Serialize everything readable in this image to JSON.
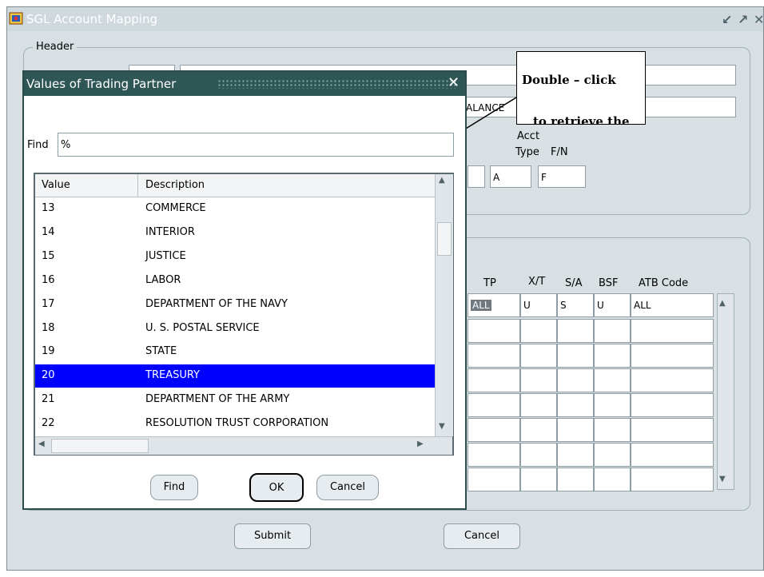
{
  "window": {
    "title": "SGL Account Mapping"
  },
  "header_group": {
    "legend": "Header",
    "balance_fragment": "ALANCE",
    "col_labels": [
      "Acct",
      "Type",
      "F/N"
    ],
    "values": {
      "acct_type": "A",
      "fn": "F"
    }
  },
  "detail_group": {
    "columns": [
      "TP",
      "X/T",
      "S/A",
      "BSF",
      "ATB Code"
    ],
    "first_row": [
      "ALL",
      "U",
      "S",
      "U",
      "ALL"
    ]
  },
  "footer": {
    "submit_label": "Submit",
    "cancel_label": "Cancel"
  },
  "dialog": {
    "title": "Values of Trading Partner",
    "find_label": "Find",
    "find_value": "%",
    "columns": [
      "Value",
      "Description"
    ],
    "rows": [
      {
        "value": "13",
        "description": "COMMERCE"
      },
      {
        "value": "14",
        "description": "INTERIOR"
      },
      {
        "value": "15",
        "description": "JUSTICE"
      },
      {
        "value": "16",
        "description": "LABOR"
      },
      {
        "value": "17",
        "description": "DEPARTMENT OF THE NAVY"
      },
      {
        "value": "18",
        "description": "U. S. POSTAL SERVICE"
      },
      {
        "value": "19",
        "description": "STATE"
      },
      {
        "value": "20",
        "description": "TREASURY"
      },
      {
        "value": "21",
        "description": "DEPARTMENT OF THE ARMY"
      },
      {
        "value": "22",
        "description": "RESOLUTION TRUST CORPORATION"
      }
    ],
    "selected_value": "20",
    "buttons": {
      "find": "Find",
      "ok": "OK",
      "cancel": "Cancel"
    }
  },
  "callout": {
    "line1": "Double – click",
    "line2": "to retrieve the"
  },
  "colors": {
    "selection": "#0000ff",
    "dialog_title": "#2e5654",
    "window_bg": "#d8e0e4"
  }
}
